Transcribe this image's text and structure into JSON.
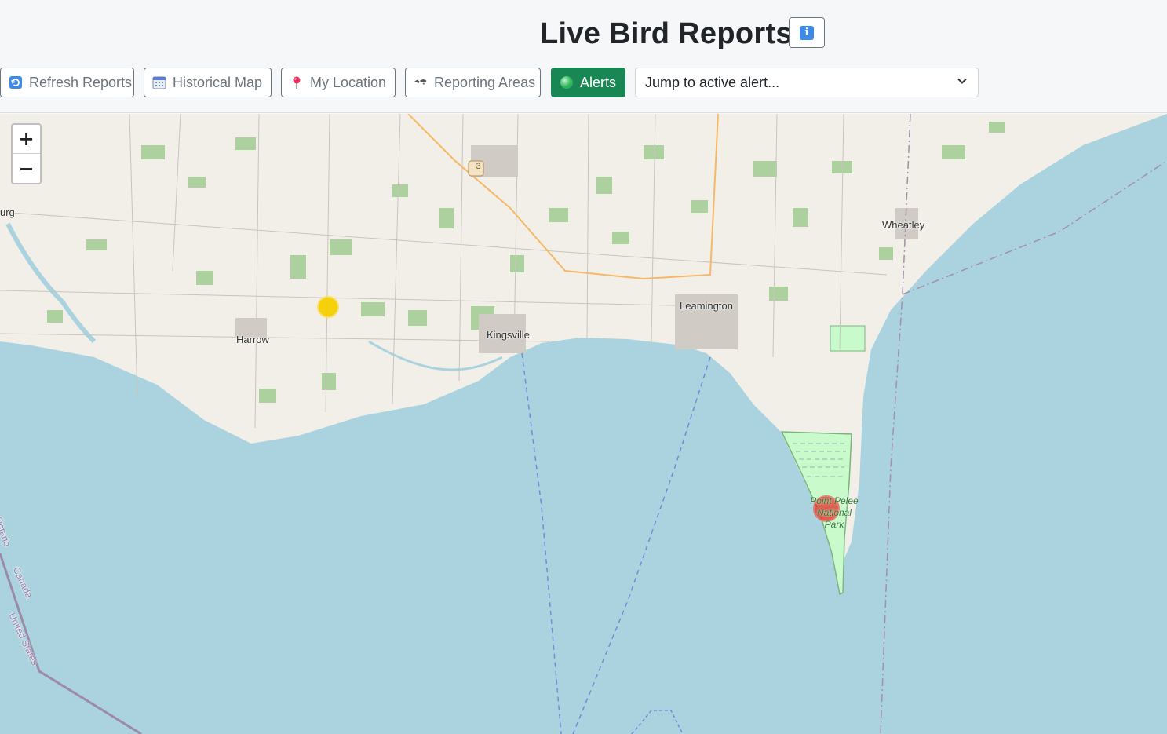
{
  "header": {
    "title": "Live Bird Reports",
    "info_icon": "info-icon"
  },
  "toolbar": {
    "refresh_label": "Refresh Reports",
    "historical_label": "Historical Map",
    "location_label": "My Location",
    "areas_label": "Reporting Areas",
    "alerts_label": "Alerts"
  },
  "alert_select": {
    "selected": "Jump to active alert..."
  },
  "map": {
    "zoom_in": "+",
    "zoom_out": "−",
    "places": {
      "harrow": "Harrow",
      "kingsville": "Kingsville",
      "leamington": "Leamington",
      "wheatley": "Wheatley",
      "burg": "urg",
      "park": "Point Pelee National Park",
      "park_l1": "Point Pelee",
      "park_l2": "National",
      "park_l3": "Park",
      "ontario": "Ontario",
      "canada": "Canada",
      "united_states": "United States",
      "highway_3": "3"
    },
    "markers": [
      {
        "name": "yellow-report-marker",
        "color": "#f5d000"
      },
      {
        "name": "red-report-marker",
        "color": "#e0463b"
      }
    ],
    "colors": {
      "water": "#aad3df",
      "land": "#f2efe9",
      "park": "#c8facc",
      "forest": "#add19e",
      "road": "#f6b867"
    }
  }
}
